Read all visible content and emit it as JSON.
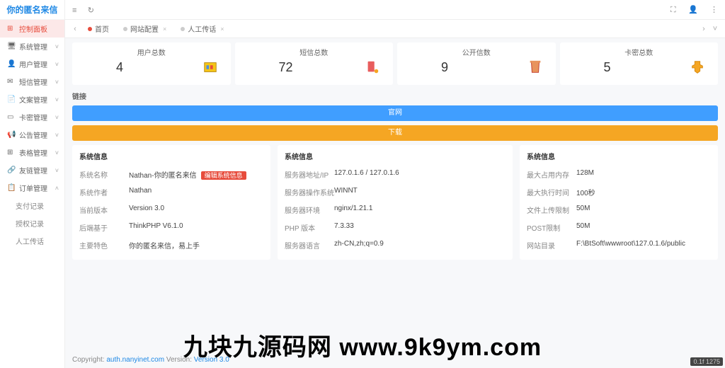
{
  "logo": "你的匿名来信",
  "nav": [
    {
      "icon": "⊞",
      "label": "控制面板",
      "active": true,
      "chev": ""
    },
    {
      "icon": "🖥",
      "label": "系统管理",
      "chev": "˅"
    },
    {
      "icon": "👤",
      "label": "用户管理",
      "chev": "˅"
    },
    {
      "icon": "✉",
      "label": "短信管理",
      "chev": "˅"
    },
    {
      "icon": "📄",
      "label": "文案管理",
      "chev": "˅"
    },
    {
      "icon": "▭",
      "label": "卡密管理",
      "chev": "˅"
    },
    {
      "icon": "📢",
      "label": "公告管理",
      "chev": "˅"
    },
    {
      "icon": "⊞",
      "label": "表格管理",
      "chev": "˅"
    },
    {
      "icon": "🔗",
      "label": "友链管理",
      "chev": "˅"
    },
    {
      "icon": "📋",
      "label": "订单管理",
      "chev": "˄",
      "expanded": true
    }
  ],
  "subnav": [
    "支付记录",
    "授权记录",
    "人工传话"
  ],
  "topbar": {
    "menu": "≡",
    "refresh": "↻",
    "expand": "⛶",
    "user": "👤",
    "more": "⋮"
  },
  "tabs": [
    {
      "dot": "#e74c3c",
      "label": "首页",
      "close": false
    },
    {
      "dot": "#ccc",
      "label": "网站配置",
      "close": true
    },
    {
      "dot": "#ccc",
      "label": "人工传话",
      "close": true
    }
  ],
  "stats": [
    {
      "title": "用户总数",
      "value": "4",
      "color": "#F5C518"
    },
    {
      "title": "短信总数",
      "value": "72",
      "color": "#E85D5D"
    },
    {
      "title": "公开信数",
      "value": "9",
      "color": "#E8935D"
    },
    {
      "title": "卡密总数",
      "value": "5",
      "color": "#F5A623"
    }
  ],
  "links": {
    "title": "链接",
    "btn1": "官网",
    "btn2": "下载"
  },
  "info1": {
    "title": "系统信息",
    "rows": [
      {
        "k": "系统名称",
        "v": "Nathan-你的匿名来信",
        "badge": "编辑系统信息"
      },
      {
        "k": "系统作者",
        "v": "Nathan"
      },
      {
        "k": "当前版本",
        "v": "Version 3.0"
      },
      {
        "k": "后端基于",
        "v": "ThinkPHP V6.1.0"
      },
      {
        "k": "主要特色",
        "v": "你的匿名来信，易上手"
      }
    ]
  },
  "info2": {
    "title": "系统信息",
    "rows": [
      {
        "k": "服务器地址/IP",
        "v": "127.0.1.6 / 127.0.1.6"
      },
      {
        "k": "服务器操作系统",
        "v": "WINNT"
      },
      {
        "k": "服务器环境",
        "v": "nginx/1.21.1"
      },
      {
        "k": "PHP 版本",
        "v": "7.3.33"
      },
      {
        "k": "服务器语言",
        "v": "zh-CN,zh;q=0.9"
      }
    ]
  },
  "info3": {
    "title": "系统信息",
    "rows": [
      {
        "k": "最大占用内存",
        "v": "128M"
      },
      {
        "k": "最大执行时间",
        "v": "100秒"
      },
      {
        "k": "文件上传限制",
        "v": "50M"
      },
      {
        "k": "POST限制",
        "v": "50M"
      },
      {
        "k": "网站目录",
        "v": "F:\\BtSoft\\wwwroot\\127.0.1.6/public"
      }
    ]
  },
  "footer": {
    "copyright": "Copyright: ",
    "link": "auth.nanyinet.com",
    "version_label": " Version: ",
    "version": "Version 3.0"
  },
  "watermark": "九块九源码网 www.9k9ym.com",
  "perf": "0.1f 1275"
}
